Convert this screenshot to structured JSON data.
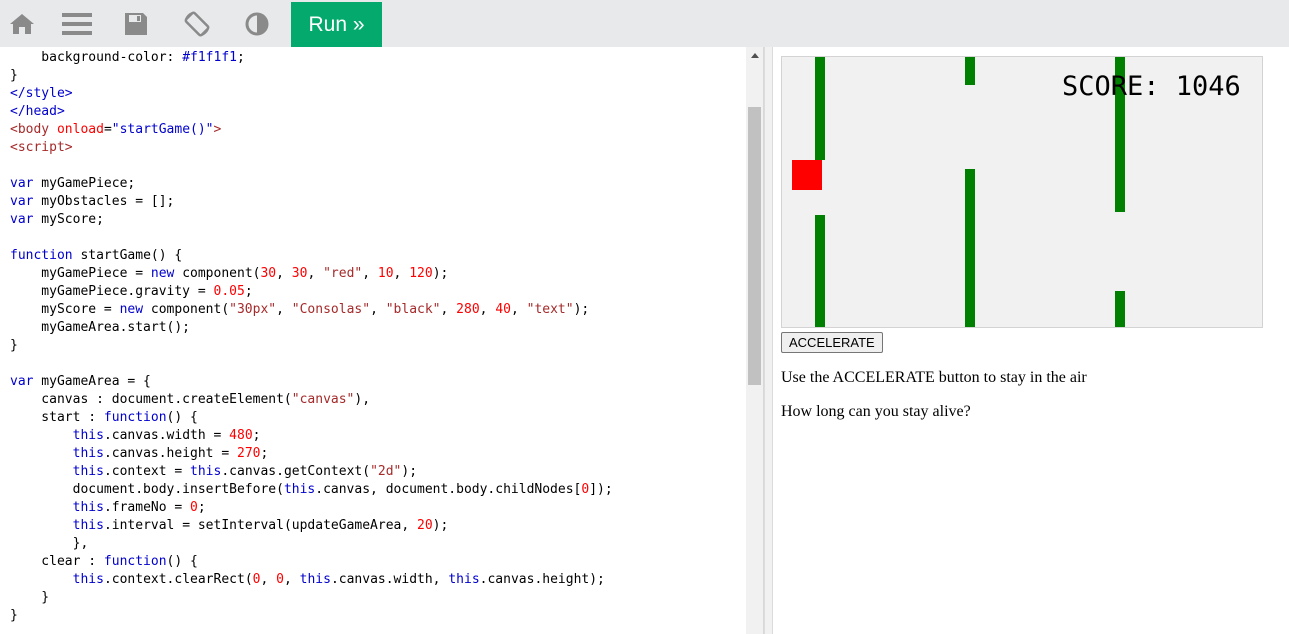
{
  "toolbar": {
    "buttons": [
      {
        "icon": "home-icon"
      },
      {
        "icon": "menu-icon"
      },
      {
        "icon": "save-icon"
      },
      {
        "icon": "rotate-icon"
      },
      {
        "icon": "contrast-icon"
      }
    ],
    "run_label": "Run »",
    "run_color": "#04aa6d"
  },
  "code_lines": [
    [
      {
        "c": "",
        "t": "    background-color: "
      },
      {
        "c": "k",
        "t": "#f1f1f1"
      },
      {
        "c": "",
        "t": ";"
      }
    ],
    [
      {
        "c": "",
        "t": "}"
      }
    ],
    [
      {
        "c": "k",
        "t": "</style>"
      }
    ],
    [
      {
        "c": "k",
        "t": "</head>"
      }
    ],
    [
      {
        "c": "r",
        "t": "<body "
      },
      {
        "c": "p",
        "t": "onload"
      },
      {
        "c": "",
        "t": "="
      },
      {
        "c": "k",
        "t": "\"startGame()\""
      },
      {
        "c": "r",
        "t": ">"
      }
    ],
    [
      {
        "c": "r",
        "t": "<script>"
      }
    ],
    [
      {
        "c": "",
        "t": ""
      }
    ],
    [
      {
        "c": "k",
        "t": "var"
      },
      {
        "c": "",
        "t": " myGamePiece;"
      }
    ],
    [
      {
        "c": "k",
        "t": "var"
      },
      {
        "c": "",
        "t": " myObstacles = [];"
      }
    ],
    [
      {
        "c": "k",
        "t": "var"
      },
      {
        "c": "",
        "t": " myScore;"
      }
    ],
    [
      {
        "c": "",
        "t": ""
      }
    ],
    [
      {
        "c": "k",
        "t": "function"
      },
      {
        "c": "",
        "t": " startGame() {"
      }
    ],
    [
      {
        "c": "",
        "t": "    myGamePiece = "
      },
      {
        "c": "k",
        "t": "new"
      },
      {
        "c": "",
        "t": " component("
      },
      {
        "c": "n",
        "t": "30"
      },
      {
        "c": "",
        "t": ", "
      },
      {
        "c": "n",
        "t": "30"
      },
      {
        "c": "",
        "t": ", "
      },
      {
        "c": "s",
        "t": "\"red\""
      },
      {
        "c": "",
        "t": ", "
      },
      {
        "c": "n",
        "t": "10"
      },
      {
        "c": "",
        "t": ", "
      },
      {
        "c": "n",
        "t": "120"
      },
      {
        "c": "",
        "t": ");"
      }
    ],
    [
      {
        "c": "",
        "t": "    myGamePiece.gravity = "
      },
      {
        "c": "n",
        "t": "0.05"
      },
      {
        "c": "",
        "t": ";"
      }
    ],
    [
      {
        "c": "",
        "t": "    myScore = "
      },
      {
        "c": "k",
        "t": "new"
      },
      {
        "c": "",
        "t": " component("
      },
      {
        "c": "s",
        "t": "\"30px\""
      },
      {
        "c": "",
        "t": ", "
      },
      {
        "c": "s",
        "t": "\"Consolas\""
      },
      {
        "c": "",
        "t": ", "
      },
      {
        "c": "s",
        "t": "\"black\""
      },
      {
        "c": "",
        "t": ", "
      },
      {
        "c": "n",
        "t": "280"
      },
      {
        "c": "",
        "t": ", "
      },
      {
        "c": "n",
        "t": "40"
      },
      {
        "c": "",
        "t": ", "
      },
      {
        "c": "s",
        "t": "\"text\""
      },
      {
        "c": "",
        "t": ");"
      }
    ],
    [
      {
        "c": "",
        "t": "    myGameArea.start();"
      }
    ],
    [
      {
        "c": "",
        "t": "}"
      }
    ],
    [
      {
        "c": "",
        "t": ""
      }
    ],
    [
      {
        "c": "k",
        "t": "var"
      },
      {
        "c": "",
        "t": " myGameArea = {"
      }
    ],
    [
      {
        "c": "",
        "t": "    canvas : document.createElement("
      },
      {
        "c": "s",
        "t": "\"canvas\""
      },
      {
        "c": "",
        "t": "),"
      }
    ],
    [
      {
        "c": "",
        "t": "    start : "
      },
      {
        "c": "k",
        "t": "function"
      },
      {
        "c": "",
        "t": "() {"
      }
    ],
    [
      {
        "c": "",
        "t": "        "
      },
      {
        "c": "k",
        "t": "this"
      },
      {
        "c": "",
        "t": ".canvas.width = "
      },
      {
        "c": "n",
        "t": "480"
      },
      {
        "c": "",
        "t": ";"
      }
    ],
    [
      {
        "c": "",
        "t": "        "
      },
      {
        "c": "k",
        "t": "this"
      },
      {
        "c": "",
        "t": ".canvas.height = "
      },
      {
        "c": "n",
        "t": "270"
      },
      {
        "c": "",
        "t": ";"
      }
    ],
    [
      {
        "c": "",
        "t": "        "
      },
      {
        "c": "k",
        "t": "this"
      },
      {
        "c": "",
        "t": ".context = "
      },
      {
        "c": "k",
        "t": "this"
      },
      {
        "c": "",
        "t": ".canvas.getContext("
      },
      {
        "c": "s",
        "t": "\"2d\""
      },
      {
        "c": "",
        "t": ");"
      }
    ],
    [
      {
        "c": "",
        "t": "        document.body.insertBefore("
      },
      {
        "c": "k",
        "t": "this"
      },
      {
        "c": "",
        "t": ".canvas, document.body.childNodes["
      },
      {
        "c": "n",
        "t": "0"
      },
      {
        "c": "",
        "t": "]);"
      }
    ],
    [
      {
        "c": "",
        "t": "        "
      },
      {
        "c": "k",
        "t": "this"
      },
      {
        "c": "",
        "t": ".frameNo = "
      },
      {
        "c": "n",
        "t": "0"
      },
      {
        "c": "",
        "t": ";"
      }
    ],
    [
      {
        "c": "",
        "t": "        "
      },
      {
        "c": "k",
        "t": "this"
      },
      {
        "c": "",
        "t": ".interval = setInterval(updateGameArea, "
      },
      {
        "c": "n",
        "t": "20"
      },
      {
        "c": "",
        "t": ");"
      }
    ],
    [
      {
        "c": "",
        "t": "        },"
      }
    ],
    [
      {
        "c": "",
        "t": "    clear : "
      },
      {
        "c": "k",
        "t": "function"
      },
      {
        "c": "",
        "t": "() {"
      }
    ],
    [
      {
        "c": "",
        "t": "        "
      },
      {
        "c": "k",
        "t": "this"
      },
      {
        "c": "",
        "t": ".context.clearRect("
      },
      {
        "c": "n",
        "t": "0"
      },
      {
        "c": "",
        "t": ", "
      },
      {
        "c": "n",
        "t": "0"
      },
      {
        "c": "",
        "t": ", "
      },
      {
        "c": "k",
        "t": "this"
      },
      {
        "c": "",
        "t": ".canvas.width, "
      },
      {
        "c": "k",
        "t": "this"
      },
      {
        "c": "",
        "t": ".canvas.height);"
      }
    ],
    [
      {
        "c": "",
        "t": "    }"
      }
    ],
    [
      {
        "c": "",
        "t": "}"
      }
    ]
  ],
  "result": {
    "score_text": "SCORE: 1046",
    "accelerate_label": "ACCELERATE",
    "instruction": "Use the ACCELERATE button to stay in the air",
    "question": "How long can you stay alive?",
    "obstacle_color": "#008000",
    "piece_color": "#ff0000",
    "canvas_background": "#f1f1f1"
  }
}
